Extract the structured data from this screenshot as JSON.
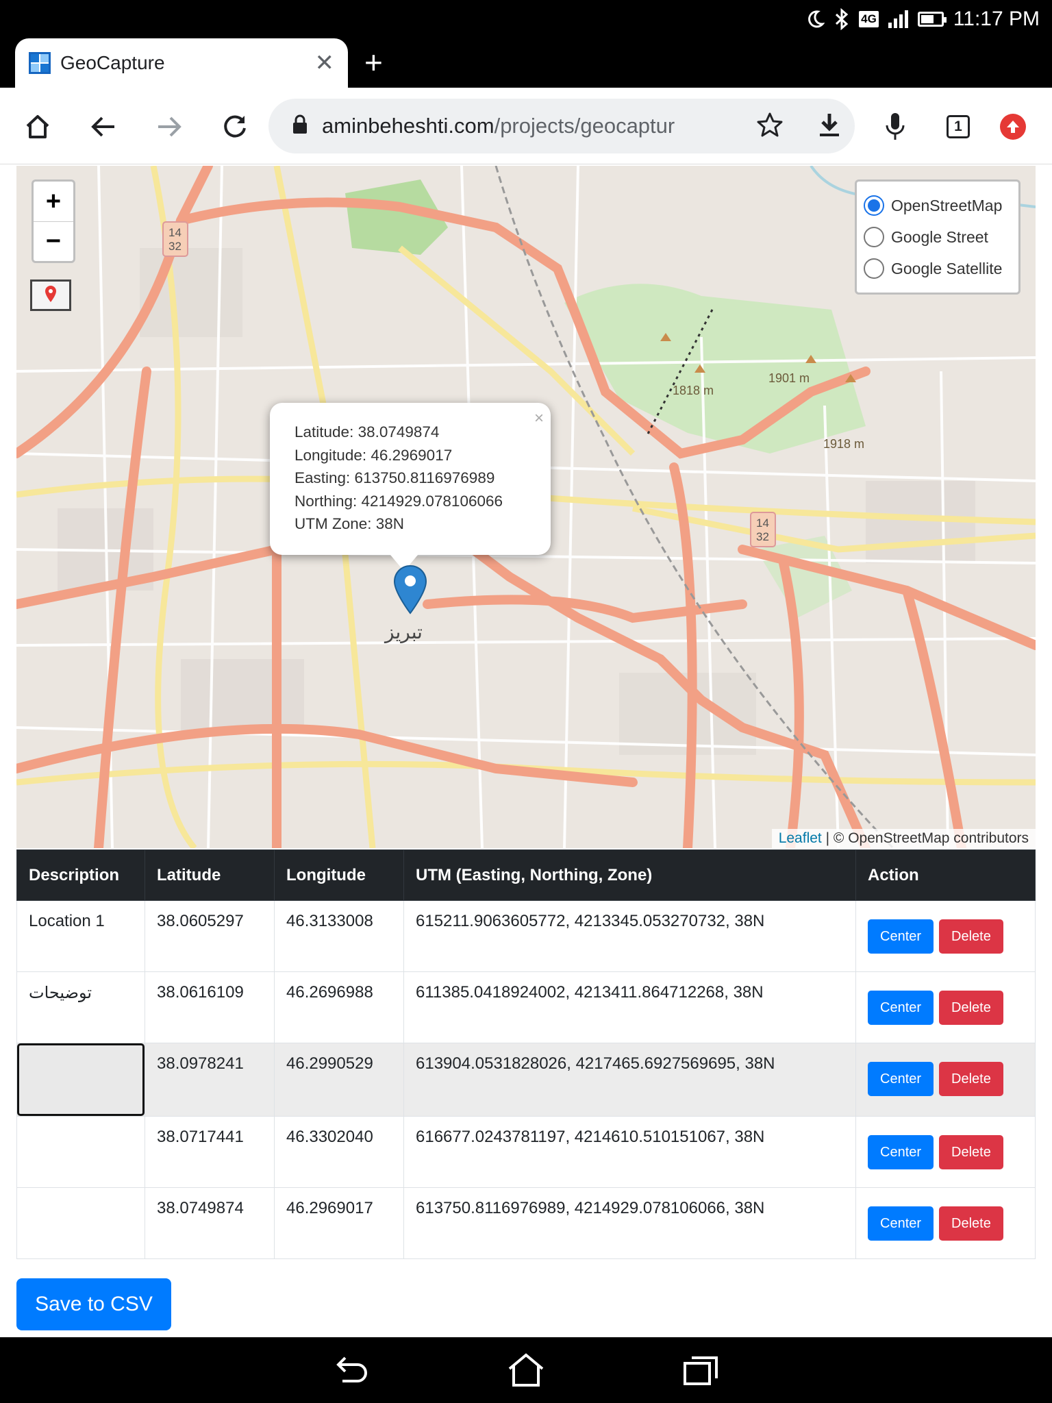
{
  "status_bar": {
    "time": "11:17 PM",
    "network": "4G",
    "icons": [
      "moon-icon",
      "bluetooth-icon",
      "signal-icon",
      "battery-icon"
    ]
  },
  "browser": {
    "tab_title": "GeoCapture",
    "url_host": "aminbeheshti.com",
    "url_path": "/projects/geocaptur",
    "tab_count": "1"
  },
  "map": {
    "zoom_in": "+",
    "zoom_out": "−",
    "layers": [
      {
        "label": "OpenStreetMap",
        "checked": true
      },
      {
        "label": "Google Street",
        "checked": false
      },
      {
        "label": "Google Satellite",
        "checked": false
      }
    ],
    "popup": {
      "latitude": "Latitude: 38.0749874",
      "longitude": "Longitude: 46.2969017",
      "easting": "Easting: 613750.8116976989",
      "northing": "Northing: 4214929.078106066",
      "zone": "UTM Zone: 38N",
      "close": "×"
    },
    "attribution_link": "Leaflet",
    "attribution_text": " | © OpenStreetMap contributors",
    "labels": {
      "city": "تبریز",
      "peak1": "1901 m",
      "peak2": "1818 m",
      "peak3": "1918 m",
      "route1_a": "14",
      "route1_b": "32",
      "route2_a": "14",
      "route2_b": "32"
    }
  },
  "table": {
    "headers": [
      "Description",
      "Latitude",
      "Longitude",
      "UTM (Easting, Northing, Zone)",
      "Action"
    ],
    "rows": [
      {
        "description": "Location 1",
        "lat": "38.0605297",
        "lon": "46.3133008",
        "utm": "615211.9063605772, 4213345.053270732, 38N"
      },
      {
        "description": "توضیحات",
        "lat": "38.0616109",
        "lon": "46.2696988",
        "utm": "611385.0418924002, 4213411.864712268, 38N"
      },
      {
        "description": "",
        "lat": "38.0978241",
        "lon": "46.2990529",
        "utm": "613904.0531828026, 4217465.6927569695, 38N"
      },
      {
        "description": "",
        "lat": "38.0717441",
        "lon": "46.3302040",
        "utm": "616677.0243781197, 4214610.510151067, 38N"
      },
      {
        "description": "",
        "lat": "38.0749874",
        "lon": "46.2969017",
        "utm": "613750.8116976989, 4214929.078106066, 38N"
      }
    ],
    "center_label": "Center",
    "delete_label": "Delete"
  },
  "save_label": "Save to CSV",
  "colors": {
    "primary": "#007bff",
    "danger": "#dc3545",
    "header": "#212529",
    "road": "#f2a085",
    "park": "#c8e6b3"
  }
}
